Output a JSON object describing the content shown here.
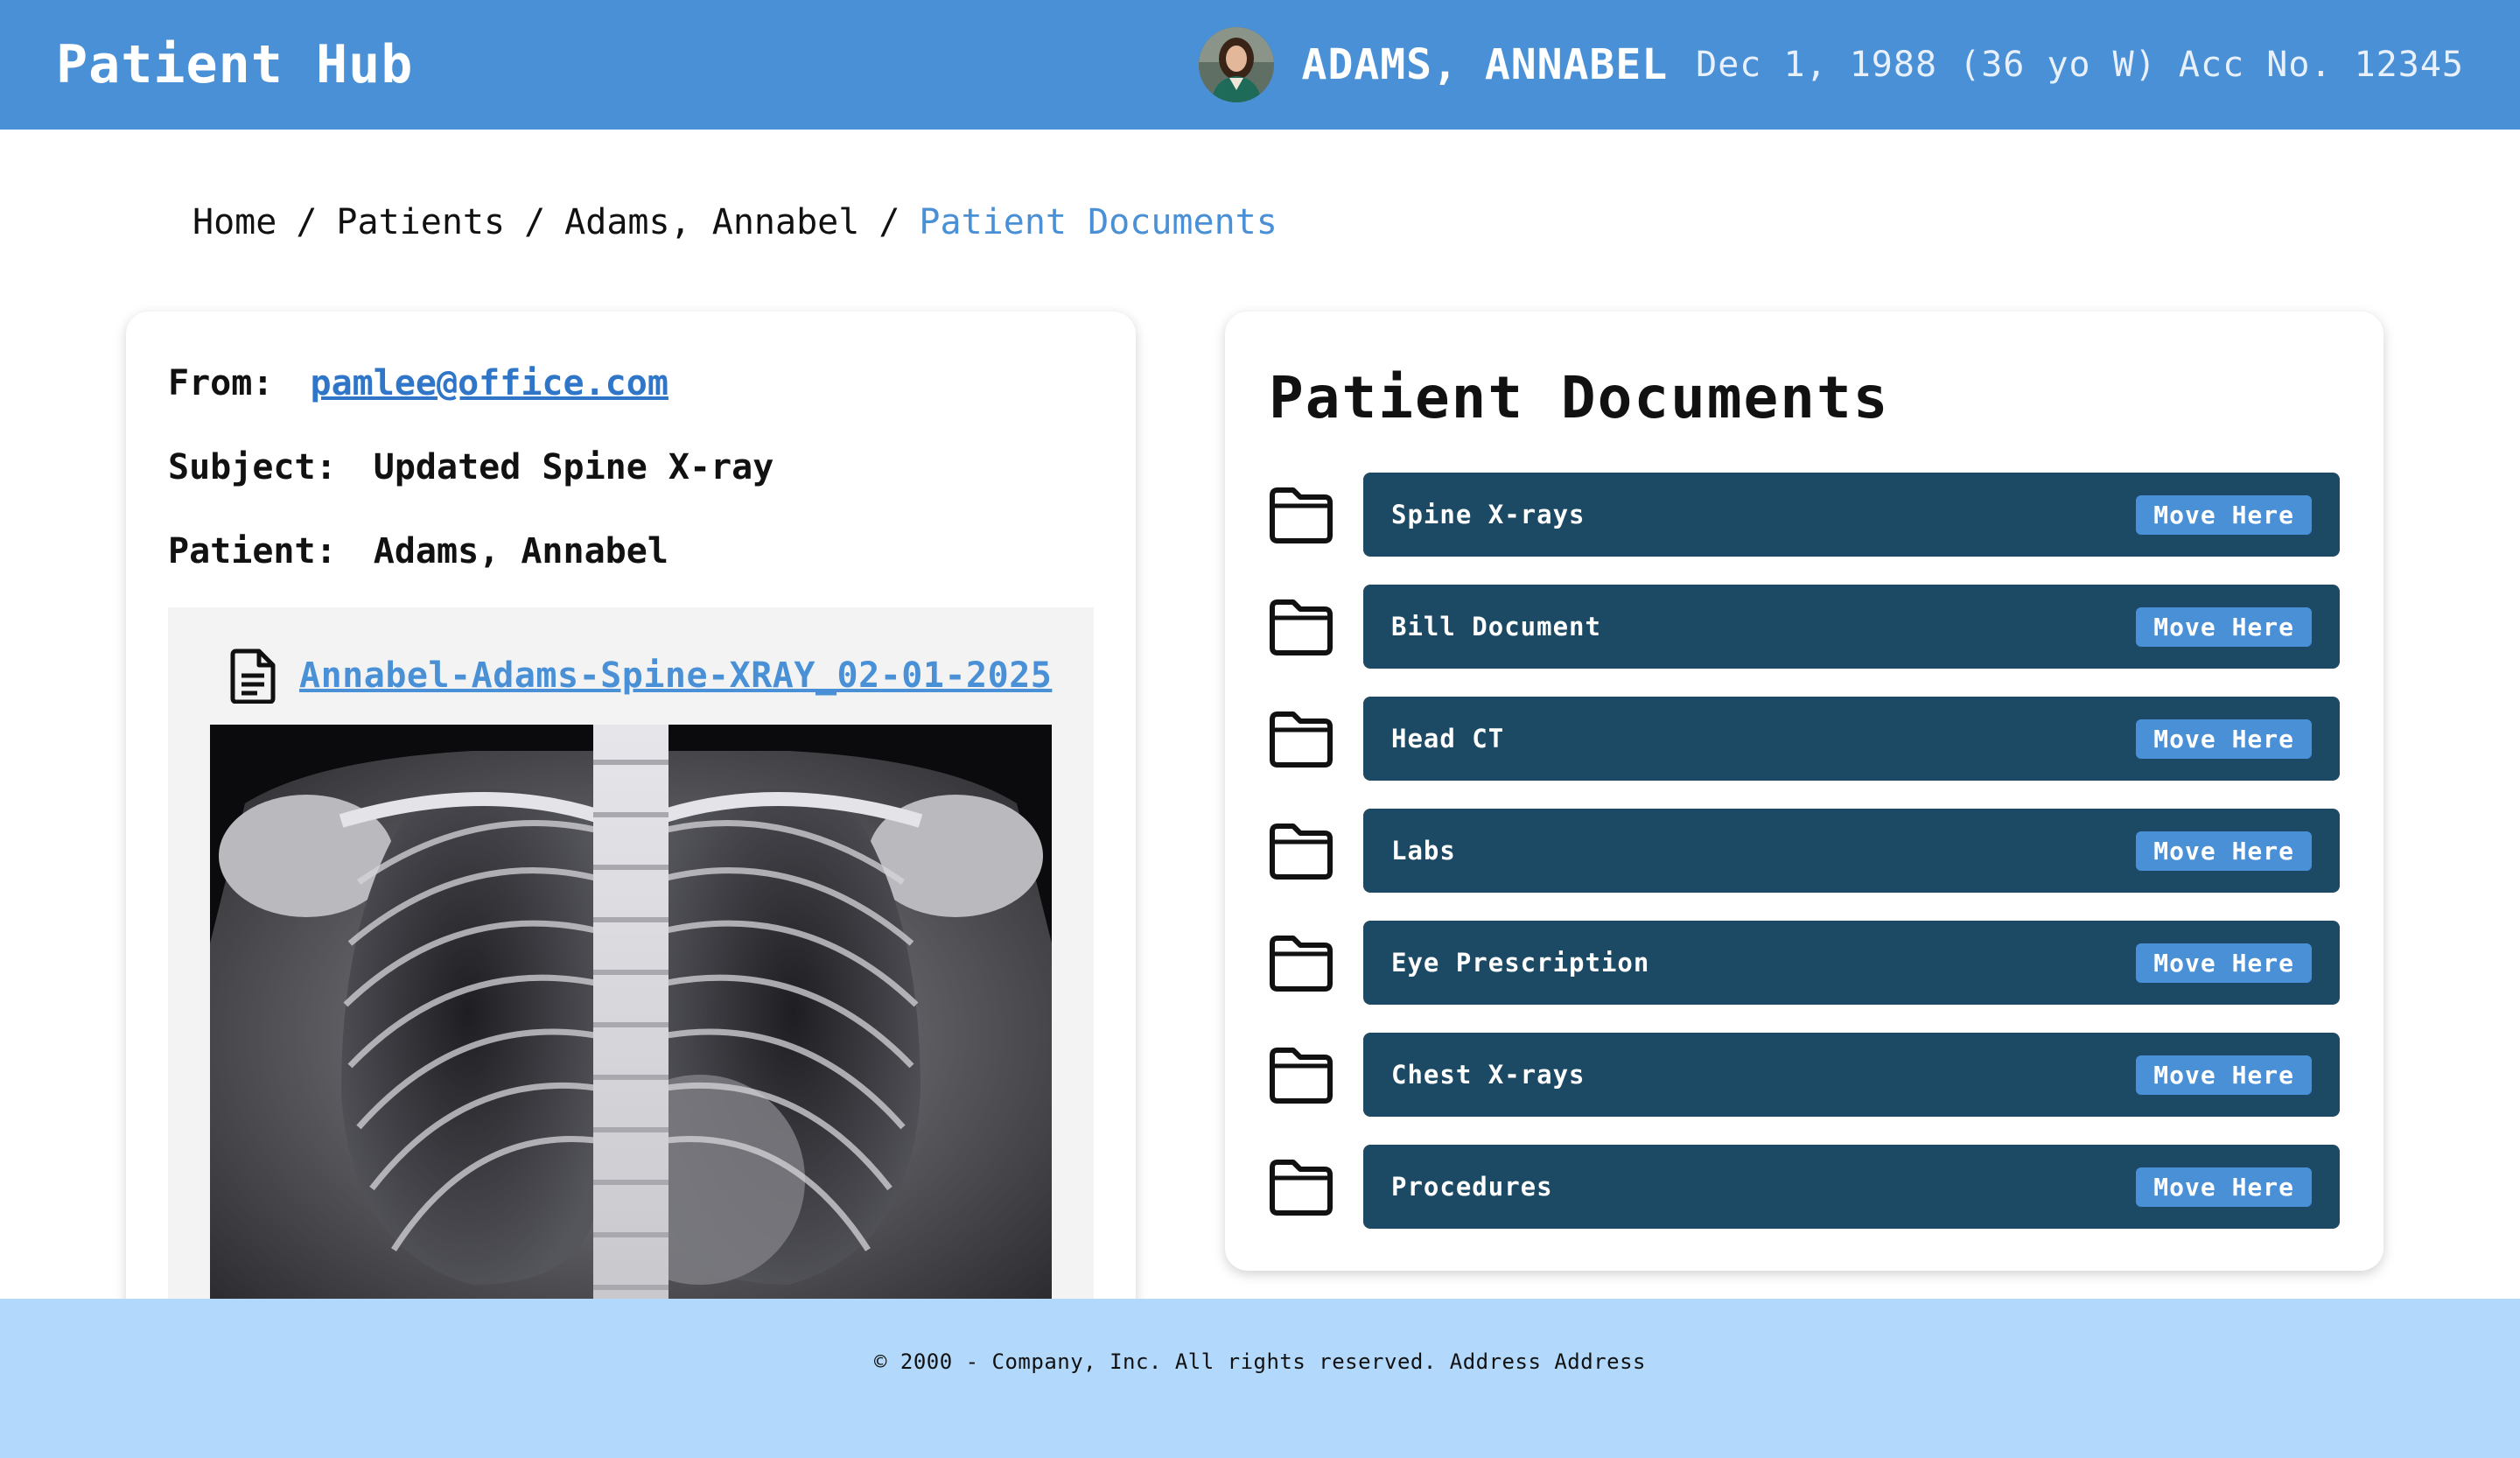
{
  "header": {
    "brand": "Patient Hub",
    "patient_name": "ADAMS, ANNABEL",
    "patient_info": "Dec 1, 1988 (36 yo W) Acc No. 12345"
  },
  "breadcrumb": {
    "items": [
      "Home",
      "Patients",
      "Adams, Annabel"
    ],
    "separator": "/",
    "current": "Patient Documents"
  },
  "email": {
    "from_label": "From:",
    "from_value": "pamlee@office.com",
    "subject_label": "Subject:",
    "subject_value": "Updated Spine X-ray",
    "patient_label": "Patient:",
    "patient_value": "Adams, Annabel",
    "attachment_name": "Annabel-Adams-Spine-XRAY_02-01-2025"
  },
  "documents": {
    "title": "Patient Documents",
    "move_label": "Move Here",
    "folders": [
      "Spine X-rays",
      "Bill Document",
      "Head CT",
      "Labs",
      "Eye Prescription",
      "Chest X-rays",
      "Procedures"
    ]
  },
  "footer": {
    "text": "© 2000 - Company, Inc. All rights reserved. Address Address"
  },
  "colors": {
    "header": "#4a90d6",
    "folder_bar": "#1c4a64",
    "footer": "#b2d8fb",
    "link": "#2f75c8"
  }
}
